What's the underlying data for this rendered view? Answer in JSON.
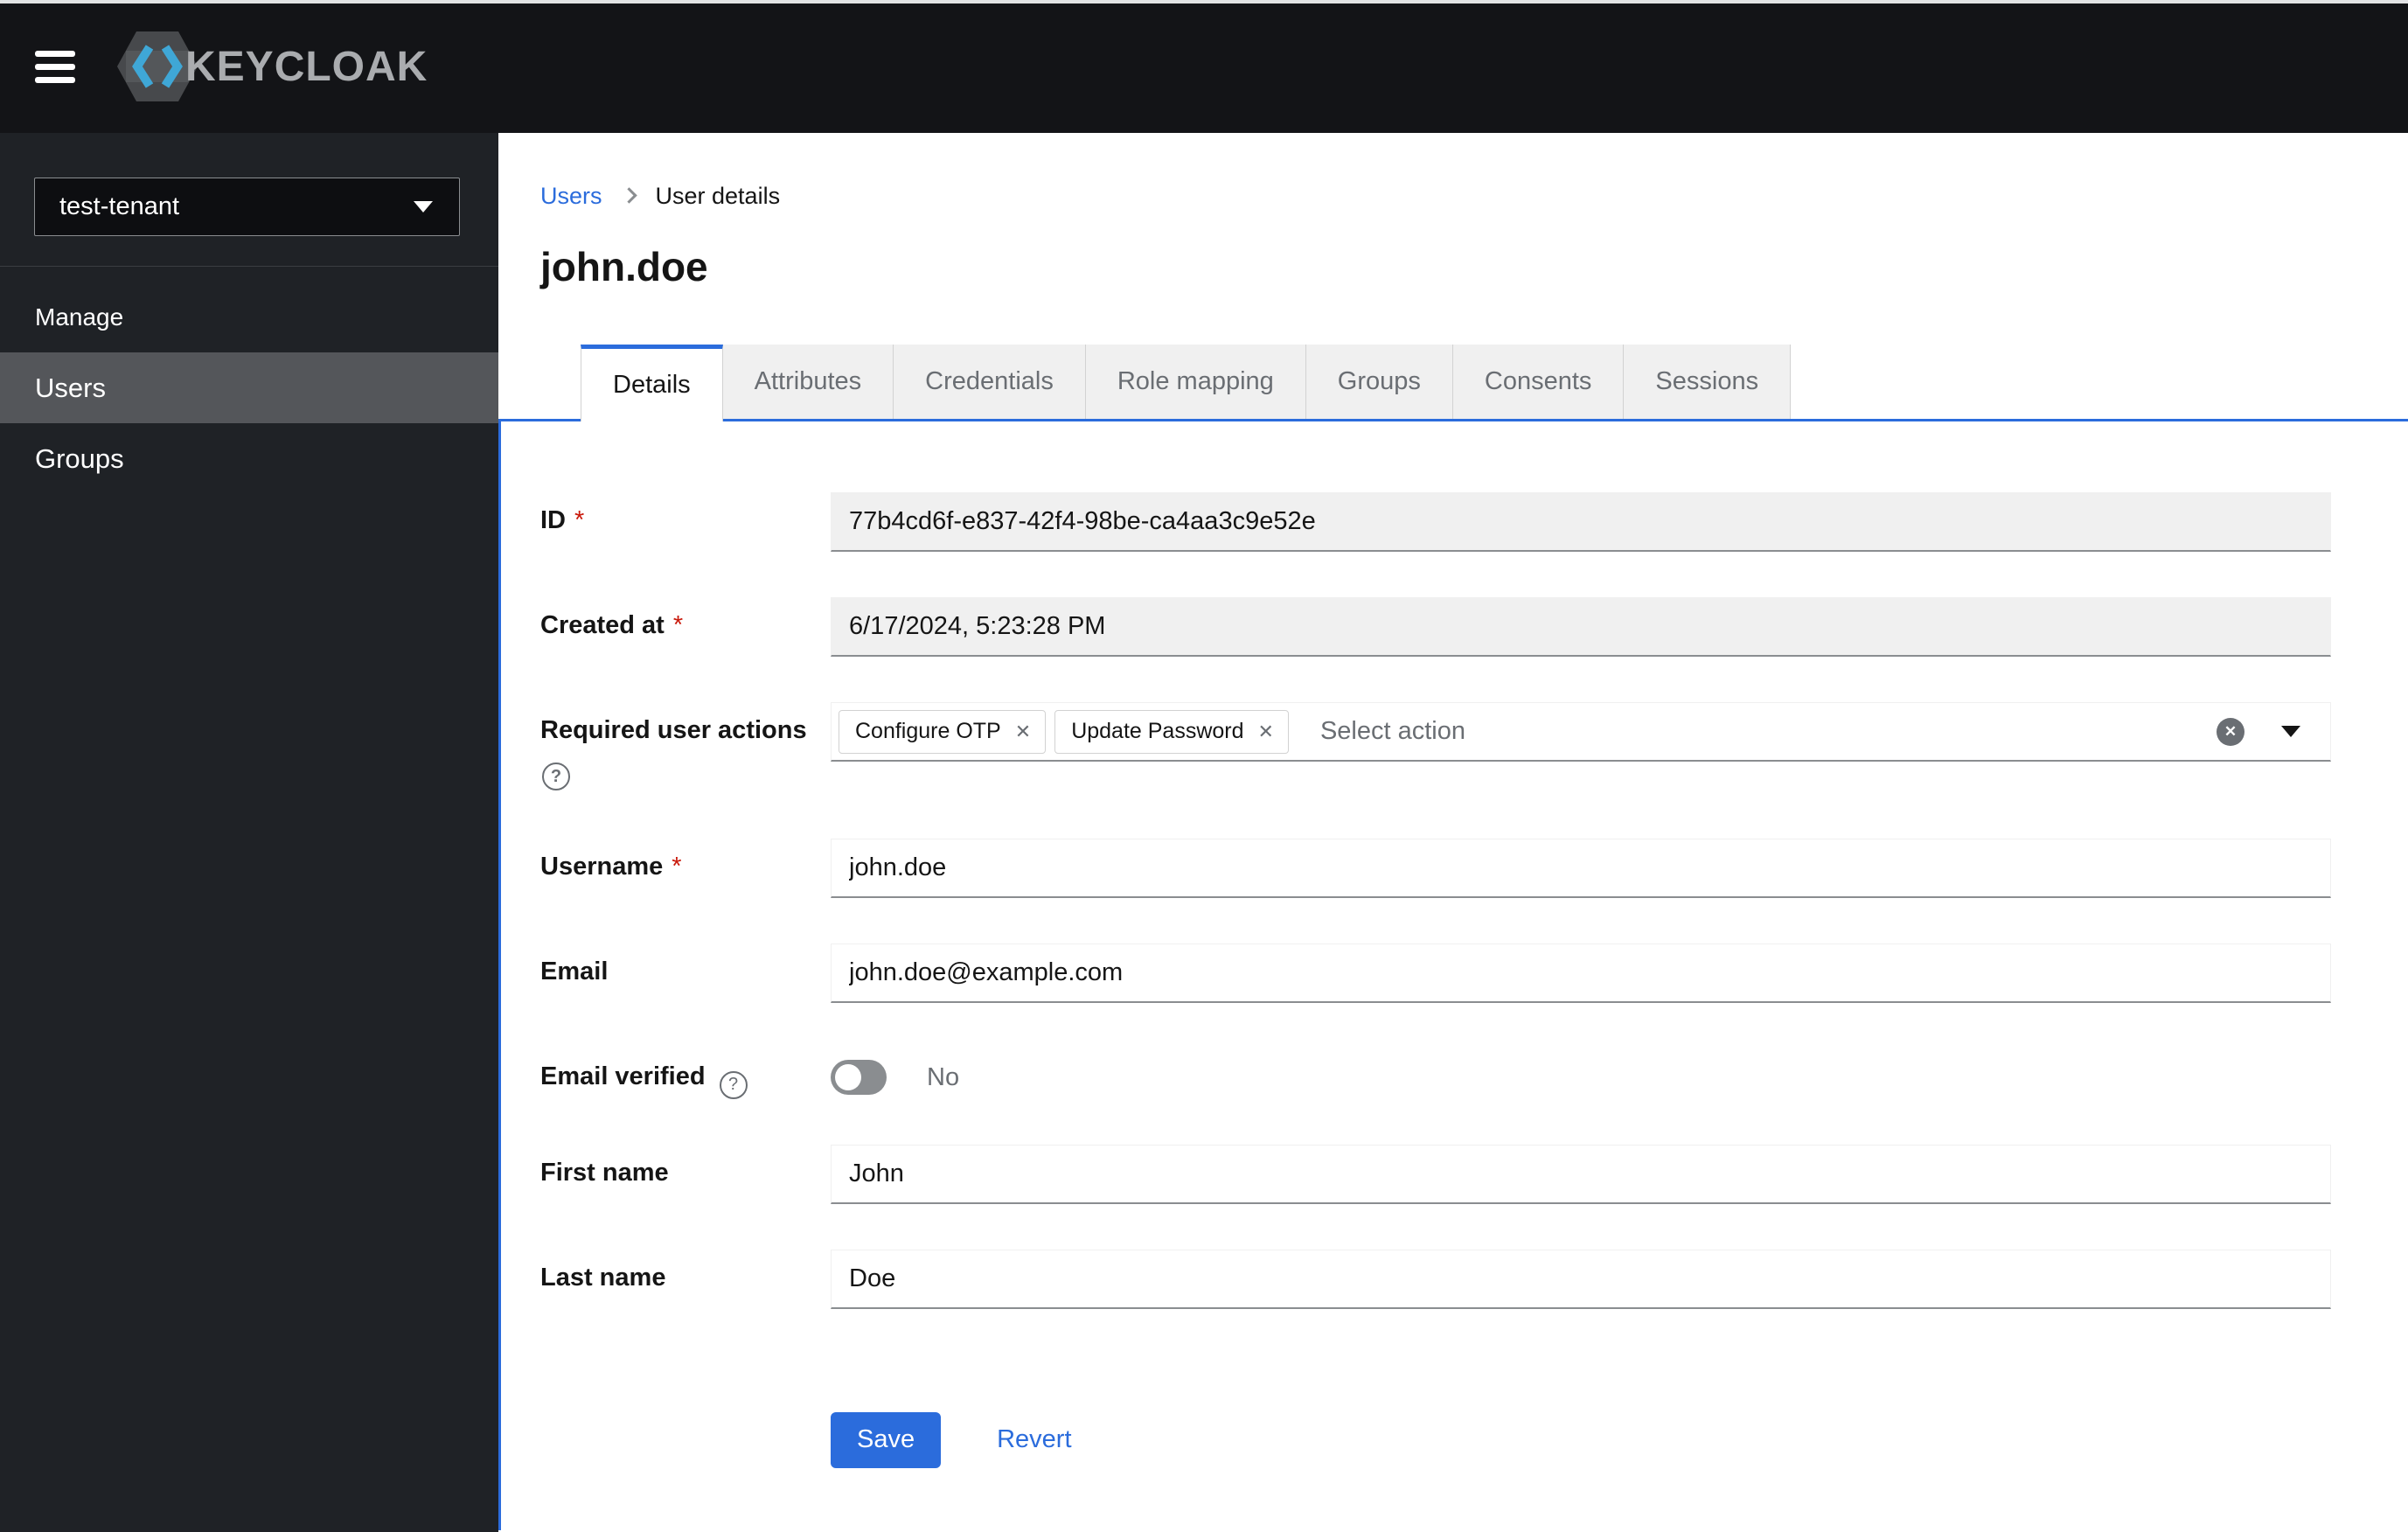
{
  "colors": {
    "accent": "#2b6cdc",
    "danger": "#c9190b",
    "header_bg": "#131417",
    "sidebar_bg": "#1f2226",
    "sidebar_active": "#54565a"
  },
  "icons": {
    "chip_close": "✕",
    "clear_all": "✕",
    "help": "?"
  },
  "header": {
    "brand": "KEYCLOAK"
  },
  "sidebar": {
    "realm_selector": {
      "value": "test-tenant"
    },
    "group_label": "Manage",
    "items": [
      {
        "label": "Users"
      },
      {
        "label": "Groups"
      }
    ]
  },
  "breadcrumb": {
    "parent": "Users",
    "current": "User details"
  },
  "page": {
    "title": "john.doe"
  },
  "tabs": [
    {
      "label": "Details"
    },
    {
      "label": "Attributes"
    },
    {
      "label": "Credentials"
    },
    {
      "label": "Role mapping"
    },
    {
      "label": "Groups"
    },
    {
      "label": "Consents"
    },
    {
      "label": "Sessions"
    }
  ],
  "form": {
    "required_indicator": "*",
    "id": {
      "label": "ID",
      "value": "77b4cd6f-e837-42f4-98be-ca4aa3c9e52e"
    },
    "created_at": {
      "label": "Created at",
      "value": "6/17/2024, 5:23:28 PM"
    },
    "required_user_actions": {
      "label": "Required user actions",
      "chips": [
        "Configure OTP",
        "Update Password"
      ],
      "placeholder": "Select action"
    },
    "username": {
      "label": "Username",
      "value": "john.doe"
    },
    "email": {
      "label": "Email",
      "value": "john.doe@example.com"
    },
    "email_verified": {
      "label": "Email verified",
      "value": "No"
    },
    "first_name": {
      "label": "First name",
      "value": "John"
    },
    "last_name": {
      "label": "Last name",
      "value": "Doe"
    }
  },
  "actions": {
    "save": "Save",
    "revert": "Revert"
  }
}
